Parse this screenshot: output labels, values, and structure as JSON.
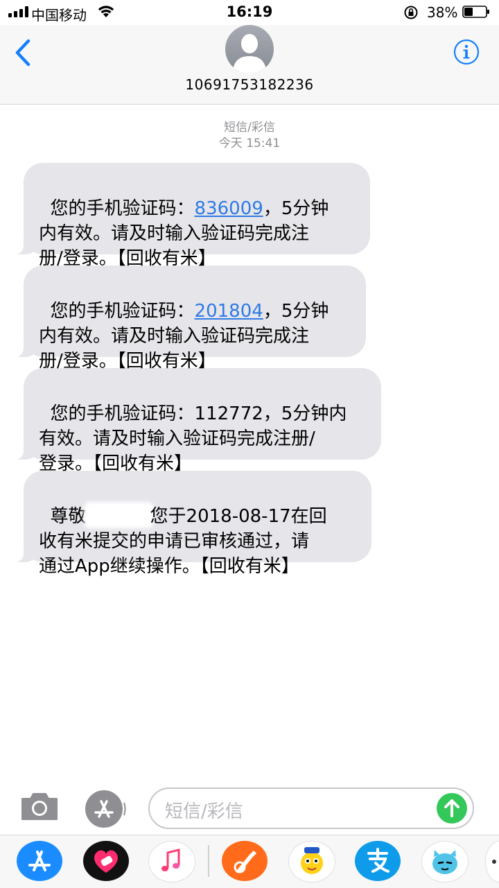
{
  "status_bar": {
    "carrier": "中国移动",
    "time": "16:19",
    "battery": "38%"
  },
  "header": {
    "contact": "10691753182236",
    "back_icon": "chevron-left-icon",
    "info_icon": "info-icon"
  },
  "conversation": {
    "service_label": "短信/彩信",
    "timestamp": "今天 15:41",
    "messages": [
      {
        "pre": "您的手机验证码：",
        "code": "836009",
        "rest": "，5分钟\n内有效。请及时输入验证码完成注\n册/登录。【回收有米】"
      },
      {
        "pre": "您的手机验证码：",
        "code": "201804",
        "rest": "，5分钟\n内有效。请及时输入验证码完成注\n册/登录。【回收有米】"
      },
      {
        "text": "您的手机验证码：112772，5分钟内\n有效。请及时输入验证码完成注册/\n登录。【回收有米】"
      },
      {
        "pre": "尊敬",
        "rest": "您于2018-08-17在回\n收有米提交的申请已审核通过，请\n通过App继续操作。【回收有米】"
      }
    ]
  },
  "input_bar": {
    "placeholder": "短信/彩信"
  },
  "app_drawer": {
    "apps": [
      "app-store-icon",
      "heart-app-icon",
      "music-icon",
      "garageband-icon",
      "sticker-icon",
      "alipay-icon",
      "emoji-icon"
    ]
  },
  "colors": {
    "link": "#2f7ae5",
    "bubble": "#e5e5ea",
    "accent": "#147efb",
    "send": "#34c759"
  }
}
